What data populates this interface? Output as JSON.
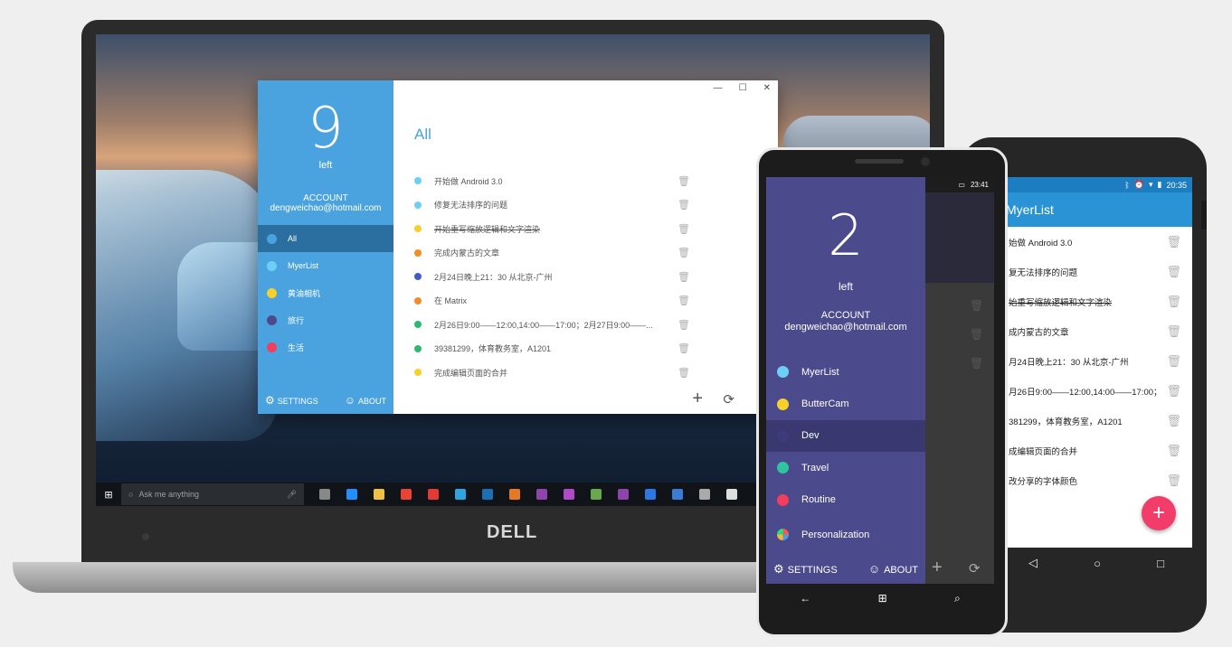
{
  "desktop_app": {
    "count": "9",
    "left_label": "left",
    "account_label": "ACCOUNT",
    "account_email": "dengweichao@hotmail.com",
    "nav": [
      {
        "label": "All",
        "color": "#4aa3df",
        "active": true
      },
      {
        "label": "MyerList",
        "color": "#6ecff6"
      },
      {
        "label": "黄油相机",
        "color": "#f7d02c"
      },
      {
        "label": "旅行",
        "color": "#4b4a8c"
      },
      {
        "label": "生活",
        "color": "#f23d5b"
      }
    ],
    "settings_label": "SETTINGS",
    "about_label": "ABOUT",
    "window_controls": [
      "—",
      "☐",
      "✕"
    ],
    "list_title": "All",
    "items": [
      {
        "text": "开始做 Android 3.0",
        "color": "#6ecff6",
        "done": false
      },
      {
        "text": "修复无法排序的问题",
        "color": "#6ecff6",
        "done": false
      },
      {
        "text": "开始重写缩放逻辑和文字渲染",
        "color": "#f7d02c",
        "done": true
      },
      {
        "text": "完成内蒙古的文章",
        "color": "#f28c28",
        "done": false
      },
      {
        "text": "2月24日晚上21：30 从北京-广州",
        "color": "#3f5ec4",
        "done": false
      },
      {
        "text": "在 Matrix",
        "color": "#f28c28",
        "done": false
      },
      {
        "text": "2月26日9:00——12:00,14:00——17:00；2月27日9:00——...",
        "color": "#2eb872",
        "done": false
      },
      {
        "text": "39381299，体育教务室，A1201",
        "color": "#2eb872",
        "done": false
      },
      {
        "text": "完成编辑页面的合并",
        "color": "#f7d02c",
        "done": false
      }
    ]
  },
  "taskbar": {
    "search_placeholder": "Ask me anything",
    "icon_colors": [
      "#888888",
      "#1e90ff",
      "#f0c040",
      "#ea4335",
      "#e53935",
      "#2ca5e0",
      "#1b6fb5",
      "#e57a22",
      "#8e44ad",
      "#b04ac8",
      "#6aa84f",
      "#8e44ad",
      "#2b78e4",
      "#3b7bd6",
      "#aaaaaa",
      "#dddddd"
    ]
  },
  "brand": "DELL",
  "windows_phone": {
    "status_time": "23:41",
    "count": "2",
    "left_label": "left",
    "account_label": "ACCOUNT",
    "account_email": "dengweichao@hotmail.com",
    "nav": [
      {
        "label": "MyerList",
        "color": "#6ecff6"
      },
      {
        "label": "ButterCam",
        "color": "#f7d02c"
      },
      {
        "label": "Dev",
        "color": "#3d3c7a",
        "active": true
      },
      {
        "label": "Travel",
        "color": "#2ec4a0"
      },
      {
        "label": "Routine",
        "color": "#f23d5b"
      }
    ],
    "personalization_label": "Personalization",
    "settings_label": "SETTINGS",
    "about_label": "ABOUT"
  },
  "android_phone": {
    "status_time": "20:35",
    "app_title": "MyerList",
    "items": [
      {
        "text": "始做 Android 3.0",
        "done": false
      },
      {
        "text": "复无法排序的问题",
        "done": false
      },
      {
        "text": "始重写缩放逻辑和文字渲染",
        "done": true
      },
      {
        "text": "成内蒙古的文章",
        "done": false
      },
      {
        "text": "月24日晚上21：30 从北京-广州",
        "done": false
      },
      {
        "text": "月26日9:00——12:00,14:00——17:00；...",
        "done": false
      },
      {
        "text": "381299，体育教务室，A1201",
        "done": false
      },
      {
        "text": "成编辑页面的合并",
        "done": false
      },
      {
        "text": "改分享的字体颜色",
        "done": false
      }
    ],
    "fab_label": "+"
  }
}
